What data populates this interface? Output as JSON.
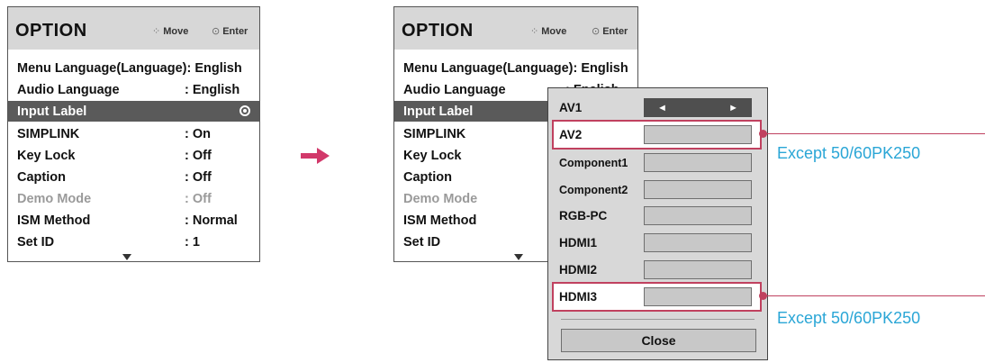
{
  "menu": {
    "title": "OPTION",
    "hint_move_icon": "move-arrows-icon",
    "hint_move": "Move",
    "hint_enter": "Enter",
    "items": [
      {
        "label": "Menu Language(Language): English",
        "value": ""
      },
      {
        "label": "Audio Language",
        "value": ": English"
      },
      {
        "label": "Input Label",
        "value": ""
      },
      {
        "label": "SIMPLINK",
        "value": ": On"
      },
      {
        "label": "Key Lock",
        "value": ": Off"
      },
      {
        "label": "Caption",
        "value": ": Off"
      },
      {
        "label": "Demo Mode",
        "value": ": Off"
      },
      {
        "label": "ISM Method",
        "value": ": Normal"
      },
      {
        "label": "Set ID",
        "value": ": 1"
      }
    ],
    "selected_item": "Input Label",
    "dimmed_item": "Demo Mode",
    "covered_value": ": English",
    "covered_value_visible": ": Fnalish"
  },
  "popup": {
    "rows": [
      {
        "label": "AV1"
      },
      {
        "label": "AV2"
      },
      {
        "label": "Component1"
      },
      {
        "label": "Component2"
      },
      {
        "label": "RGB-PC"
      },
      {
        "label": "HDMI1"
      },
      {
        "label": "HDMI2"
      },
      {
        "label": "HDMI3"
      }
    ],
    "close_label": "Close"
  },
  "callouts": [
    {
      "text": "Except 50/60PK250"
    },
    {
      "text": "Except 50/60PK250"
    }
  ],
  "colors": {
    "accent": "#c0415f",
    "arrow": "#d2386a",
    "callout_text": "#2aa6d6",
    "selected_row": "#5a5a5a"
  }
}
